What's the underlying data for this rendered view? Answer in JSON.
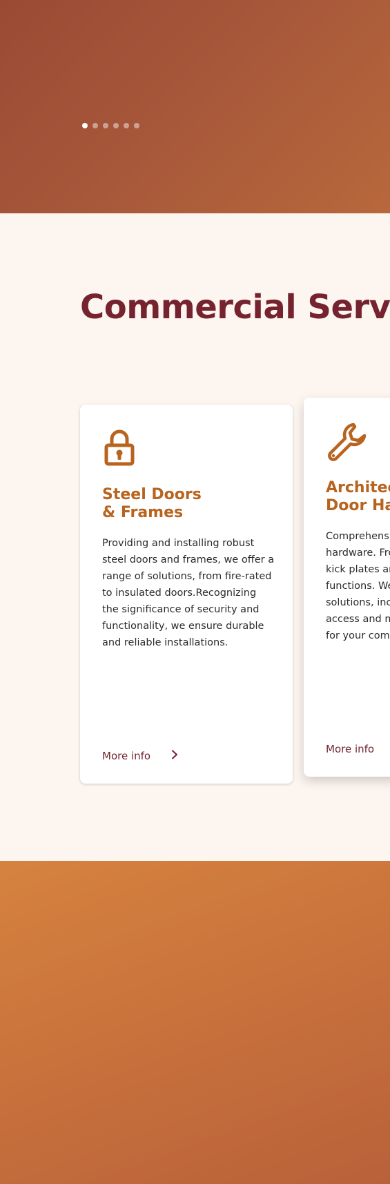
{
  "hero": {
    "slides_total": 6,
    "active_slide": 1
  },
  "services": {
    "title": "Commercial Servic",
    "cards": [
      {
        "icon": "lock-icon",
        "title": "Steel Doors\n& Frames",
        "text": "Providing and installing robust steel doors and frames, we offer a range of solutions, from fire-rated to insulated doors.Recognizing the significance of security and functionality, we ensure durable and reliable installations.",
        "link": "More info"
      },
      {
        "icon": "wrench-icon",
        "title": "Architec\nDoor Ha",
        "text_lines": [
          "Comprehensi",
          "hardware. Fro",
          "kick plates an",
          "functions. We",
          "solutions, inc",
          "access and ma",
          "for your comm"
        ],
        "link": "More info"
      }
    ]
  },
  "colors": {
    "hero_gradient_start": "#9a4a33",
    "hero_gradient_end": "#b8683b",
    "section_bg": "#fdf5f0",
    "title_color": "#74232f",
    "accent": "#b8631e",
    "footer_gradient_start": "#d6823f",
    "footer_gradient_end": "#b9613a"
  }
}
